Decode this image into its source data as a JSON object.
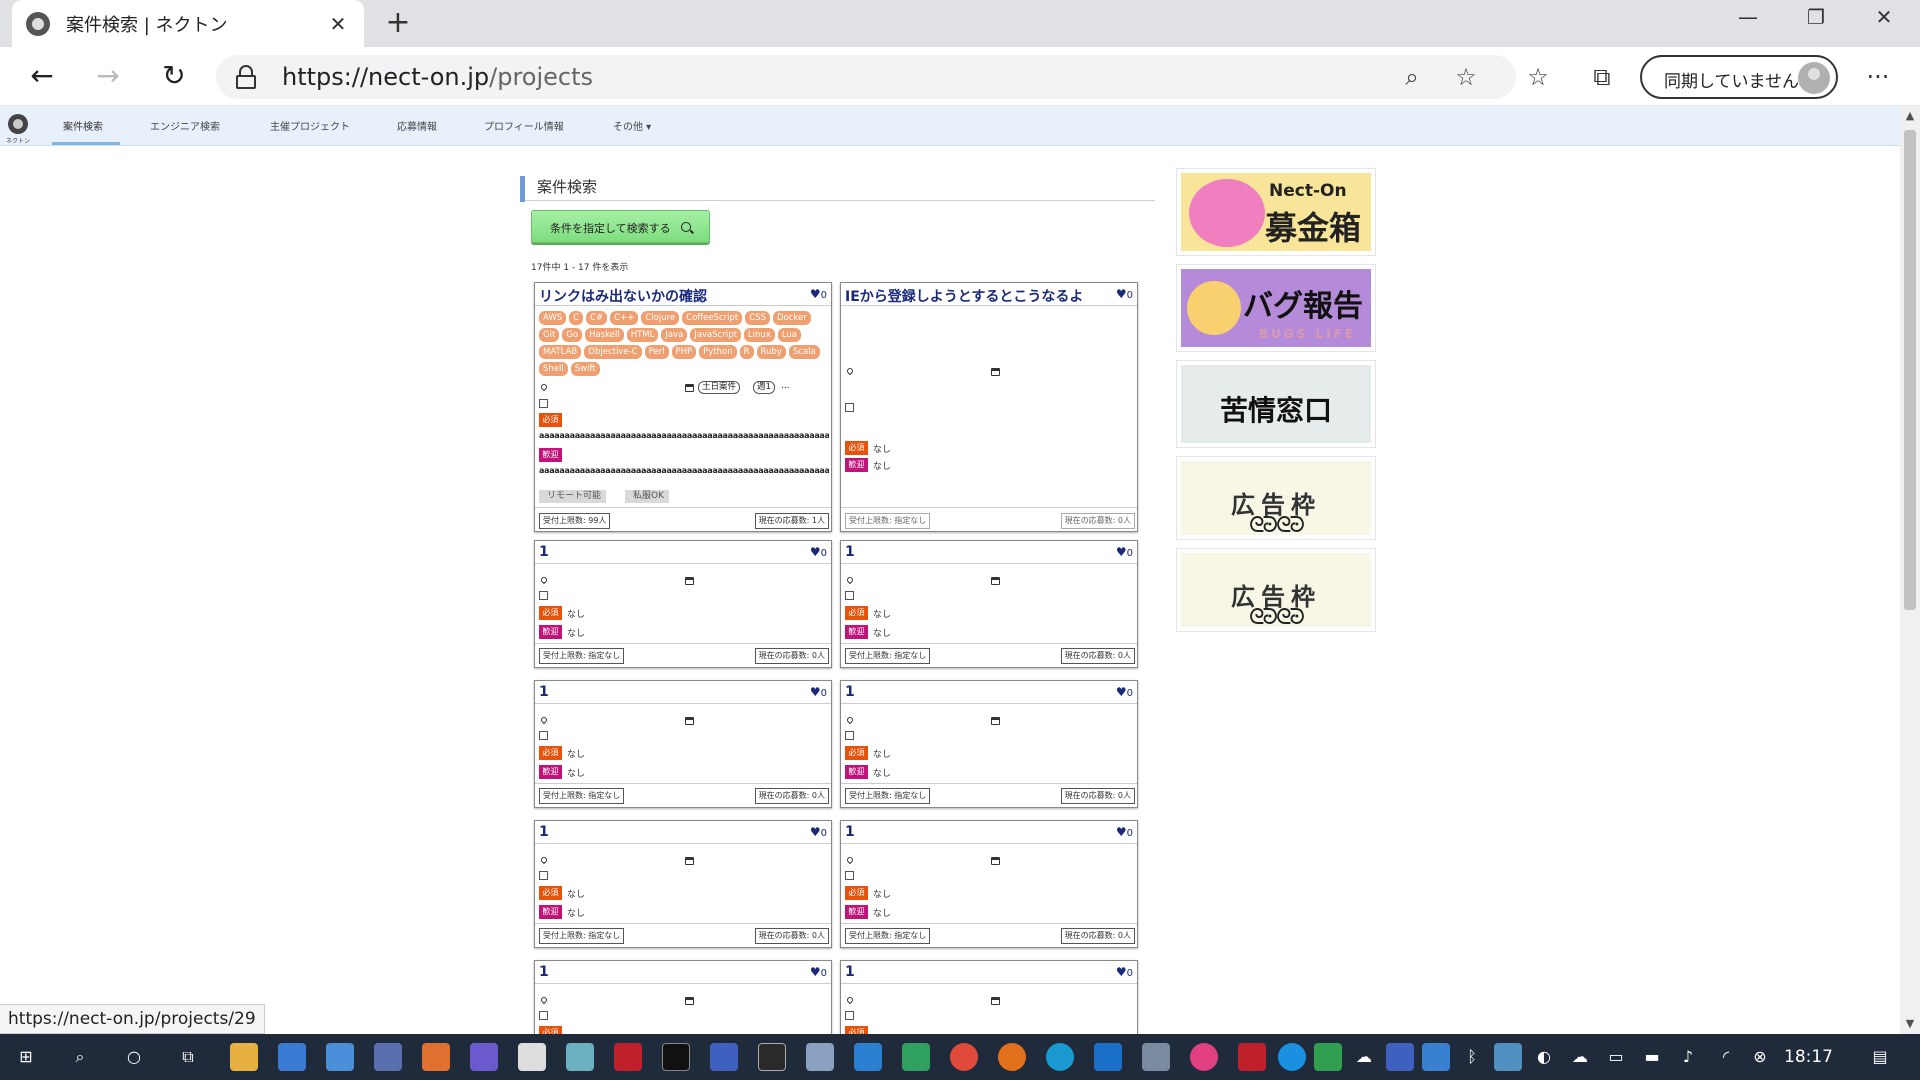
{
  "browser": {
    "tab_title": "案件検索 | ネクトン",
    "tab_close": "✕",
    "new_tab": "+",
    "url_host": "https://nect-on.jp",
    "url_path": "/projects",
    "sync_label": "同期していません",
    "win_min": "—",
    "win_max": "❐",
    "win_close": "✕",
    "back": "←",
    "forward": "→",
    "refresh": "↻",
    "zoom_icon": "⌕",
    "star_icon": "☆",
    "favorites_icon": "☆",
    "collections_icon": "⧉",
    "more_icon": "···"
  },
  "sitenav": {
    "logo_text": "ネクトン",
    "items": [
      "案件検索",
      "エンジニア検索",
      "主催プロジェクト",
      "応募情報",
      "プロフィール情報",
      "その他 ▾"
    ]
  },
  "main": {
    "section_title": "案件検索",
    "search_button": "条件を指定して検索する",
    "result_count": "17件中 1 - 17 件を表示"
  },
  "card_common": {
    "fav_heart": "♥",
    "fav_count": "0",
    "required_label": "必須",
    "welcome_label": "歓迎",
    "none": "なし",
    "accept_limit_none": "受付上限数: 指定なし",
    "current_applicants_zero": "現在の応募数: 0人"
  },
  "cards": [
    {
      "title": "リンクはみ出ないかの確認",
      "skills": [
        "AWS",
        "C",
        "C#",
        "C++",
        "Clojure",
        "CoffeeScript",
        "CSS",
        "Docker",
        "Git",
        "Go",
        "Haskell",
        "HTML",
        "Java",
        "JavaScript",
        "Linux",
        "Lua",
        "MATLAB",
        "Objective-C",
        "Perl",
        "PHP",
        "Python",
        "R",
        "Ruby",
        "Scala",
        "Shell",
        "Swift"
      ],
      "schedule_tags": [
        "土日案件",
        "週1"
      ],
      "schedule_more": "...",
      "required_text": "aaaaaaaaaaaaaaaaaaaaaaaaaaaaaaaaaaaaaaaaaaaaaaaaaaaaaaaaaaaaaaaaaaaaaaaa",
      "welcome_text": "aaaaaaaaaaaaaaaaaaaaaaaaaaaaaaaaaaaaaaaaaaaaaaaaaaaaaaaaaaaaaaaaaaaaaaaa",
      "features": [
        "リモート可能",
        "私服OK"
      ],
      "accept_limit": "受付上限数: 99人",
      "current_applicants": "現在の応募数: 1人"
    },
    {
      "title": "IEから登録しようとするとこうなるよ"
    },
    {
      "title": "1"
    },
    {
      "title": "1"
    },
    {
      "title": "1"
    },
    {
      "title": "1"
    },
    {
      "title": "1"
    },
    {
      "title": "1"
    },
    {
      "title": "1"
    },
    {
      "title": "1"
    }
  ],
  "ads": {
    "ad1_en": "Nect-On",
    "ad1_jp": "募金箱",
    "ad2_jp": "バグ報告",
    "ad2_en": "BUGS LIFE",
    "ad3_jp": "苦情窓口",
    "frame_jp": "広告枠",
    "frame_orn": "ᘓᘒᘓᘒ"
  },
  "status_url": "https://nect-on.jp/projects/29",
  "taskbar": {
    "time": "18:17"
  },
  "colors": {
    "accent_nav": "#e8f1fb",
    "required_badge": "#e8520a",
    "welcome_badge": "#c2137a",
    "card_title": "#1a2a7a",
    "skill_tag": "#f0a070"
  }
}
